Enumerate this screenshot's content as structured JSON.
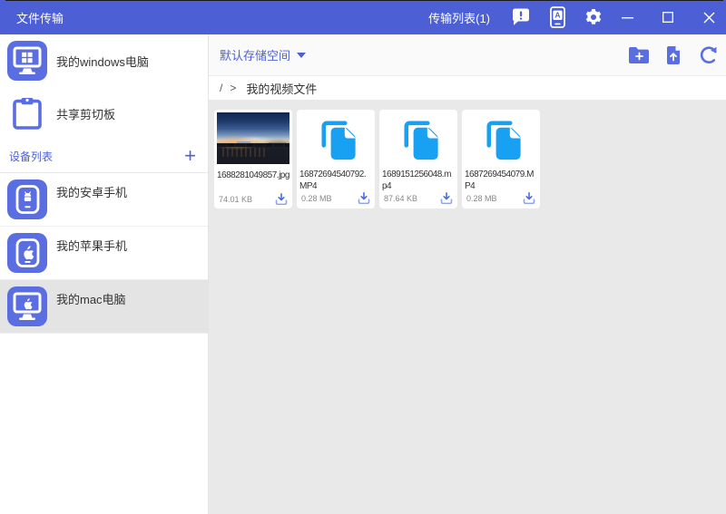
{
  "titlebar": {
    "title": "文件传输",
    "transfer_list": "传输列表(1)"
  },
  "sidebar": {
    "computer": {
      "label": "我的windows电脑"
    },
    "clipboard": {
      "label": "共享剪切板"
    },
    "device_header": {
      "label": "设备列表",
      "add": "+"
    },
    "devices": [
      {
        "label": "我的安卓手机",
        "type": "android-phone",
        "selected": false
      },
      {
        "label": "我的苹果手机",
        "type": "apple-phone",
        "selected": false
      },
      {
        "label": "我的mac电脑",
        "type": "mac-computer",
        "selected": true
      }
    ]
  },
  "toolbar": {
    "storage_selector": "默认存储空间"
  },
  "breadcrumb": {
    "root": "/",
    "separator": ">",
    "current": "我的视频文件"
  },
  "files": [
    {
      "name": "1688281049857.jpg",
      "size": "74.01 KB",
      "kind": "image"
    },
    {
      "name": "16872694540792.MP4",
      "size": "0.28 MB",
      "kind": "file"
    },
    {
      "name": "1689151256048.mp4",
      "size": "87.64 KB",
      "kind": "file"
    },
    {
      "name": "1687269454079.MP4",
      "size": "0.28 MB",
      "kind": "file"
    }
  ],
  "colors": {
    "titlebar_bg": "#4d5fd4",
    "accent_blue": "#4a5fd9",
    "icon_square_blue": "#5b6ee1",
    "file_icon_azure": "#18a0f2",
    "content_bg": "#e9e9e9",
    "selected_item_bg": "#e4e4e4"
  }
}
